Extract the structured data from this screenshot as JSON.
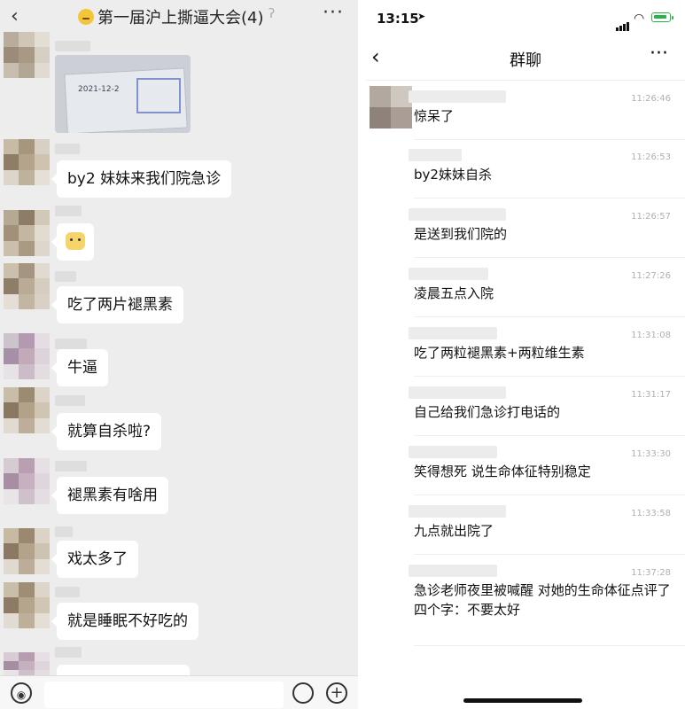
{
  "left": {
    "back_icon": "‹",
    "title": "第一届沪上撕逼大会(4)",
    "more_icon": "···",
    "image_text": "2021-12-2",
    "messages": [
      {
        "text": "by2 妹妹来我们院急诊"
      },
      {
        "text": ""
      },
      {
        "text": "吃了两片褪黑素"
      },
      {
        "text": "牛逼"
      },
      {
        "text": "就算自杀啦?"
      },
      {
        "text": "褪黑素有啥用"
      },
      {
        "text": "戏太多了"
      },
      {
        "text": "就是睡眠不好吃的"
      }
    ],
    "voice_icon": "◉",
    "plus_icon": "+"
  },
  "right": {
    "status_time": "13:15",
    "location_icon": "➤",
    "wifi_icon": "◠",
    "back_icon": "‹",
    "title": "群聊",
    "more_icon": "···",
    "messages": [
      {
        "time": "11:26:46",
        "text": "惊呆了"
      },
      {
        "time": "11:26:53",
        "text": "by2妹妹自杀"
      },
      {
        "time": "11:26:57",
        "text": "是送到我们院的"
      },
      {
        "time": "11:27:26",
        "text": "凌晨五点入院"
      },
      {
        "time": "11:31:08",
        "text": "吃了两粒褪黑素+两粒维生素"
      },
      {
        "time": "11:31:17",
        "text": "自己给我们急诊打电话的"
      },
      {
        "time": "11:33:30",
        "text": "笑得想死 说生命体征特别稳定"
      },
      {
        "time": "11:33:58",
        "text": "九点就出院了"
      },
      {
        "time": "11:37:28",
        "text": "急诊老师夜里被喊醒 对她的生命体征点评了四个字：不要太好"
      }
    ]
  },
  "colors": {
    "left_bg": "#ededed",
    "bubble": "#ffffff",
    "battery": "#2bb24c"
  }
}
